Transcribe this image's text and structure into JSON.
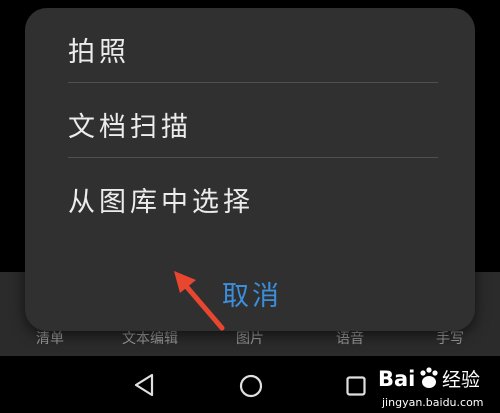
{
  "dialog": {
    "items": [
      {
        "label": "拍照"
      },
      {
        "label": "文档扫描"
      },
      {
        "label": "从图库中选择"
      }
    ],
    "cancel_label": "取消"
  },
  "background_tabs": [
    {
      "label": "清单"
    },
    {
      "label": "文本编辑"
    },
    {
      "label": "图片"
    },
    {
      "label": "语音"
    },
    {
      "label": "手写"
    }
  ],
  "navbar": {
    "back_icon": "triangle-back-icon",
    "home_icon": "circle-home-icon",
    "recent_icon": "square-recent-icon"
  },
  "watermark": {
    "brand": "Baidu",
    "brand_cn": "经验",
    "url": "jingyan.baidu.com"
  },
  "colors": {
    "dialog_bg": "#303030",
    "accent": "#3c8edb",
    "arrow": "#e8462f"
  }
}
